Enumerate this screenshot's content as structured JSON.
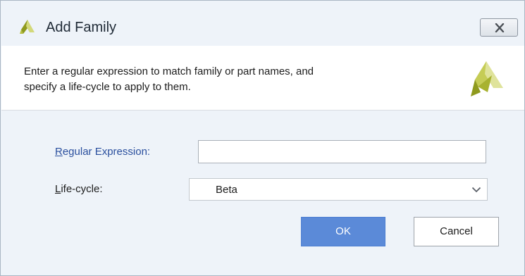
{
  "window": {
    "title": "Add Family"
  },
  "banner": {
    "line1": "Enter a regular expression to match family or part names, and",
    "line2": "specify a life-cycle to apply to them."
  },
  "form": {
    "regex_label_first": "R",
    "regex_label_rest": "egular Expression:",
    "regex_value": "",
    "lifecycle_label_first": "L",
    "lifecycle_label_rest": "ife-cycle:",
    "lifecycle_value": "Beta"
  },
  "buttons": {
    "ok_label": "OK",
    "cancel_label": "Cancel"
  },
  "icons": {
    "title_logo": "app-logo-icon",
    "close": "close-icon",
    "banner_logo": "banner-logo-icon",
    "dropdown": "chevron-down-icon"
  },
  "colors": {
    "accent": "#5b8ad8",
    "logo_dark": "#8f9a1e",
    "logo_light": "#d9df8a"
  }
}
